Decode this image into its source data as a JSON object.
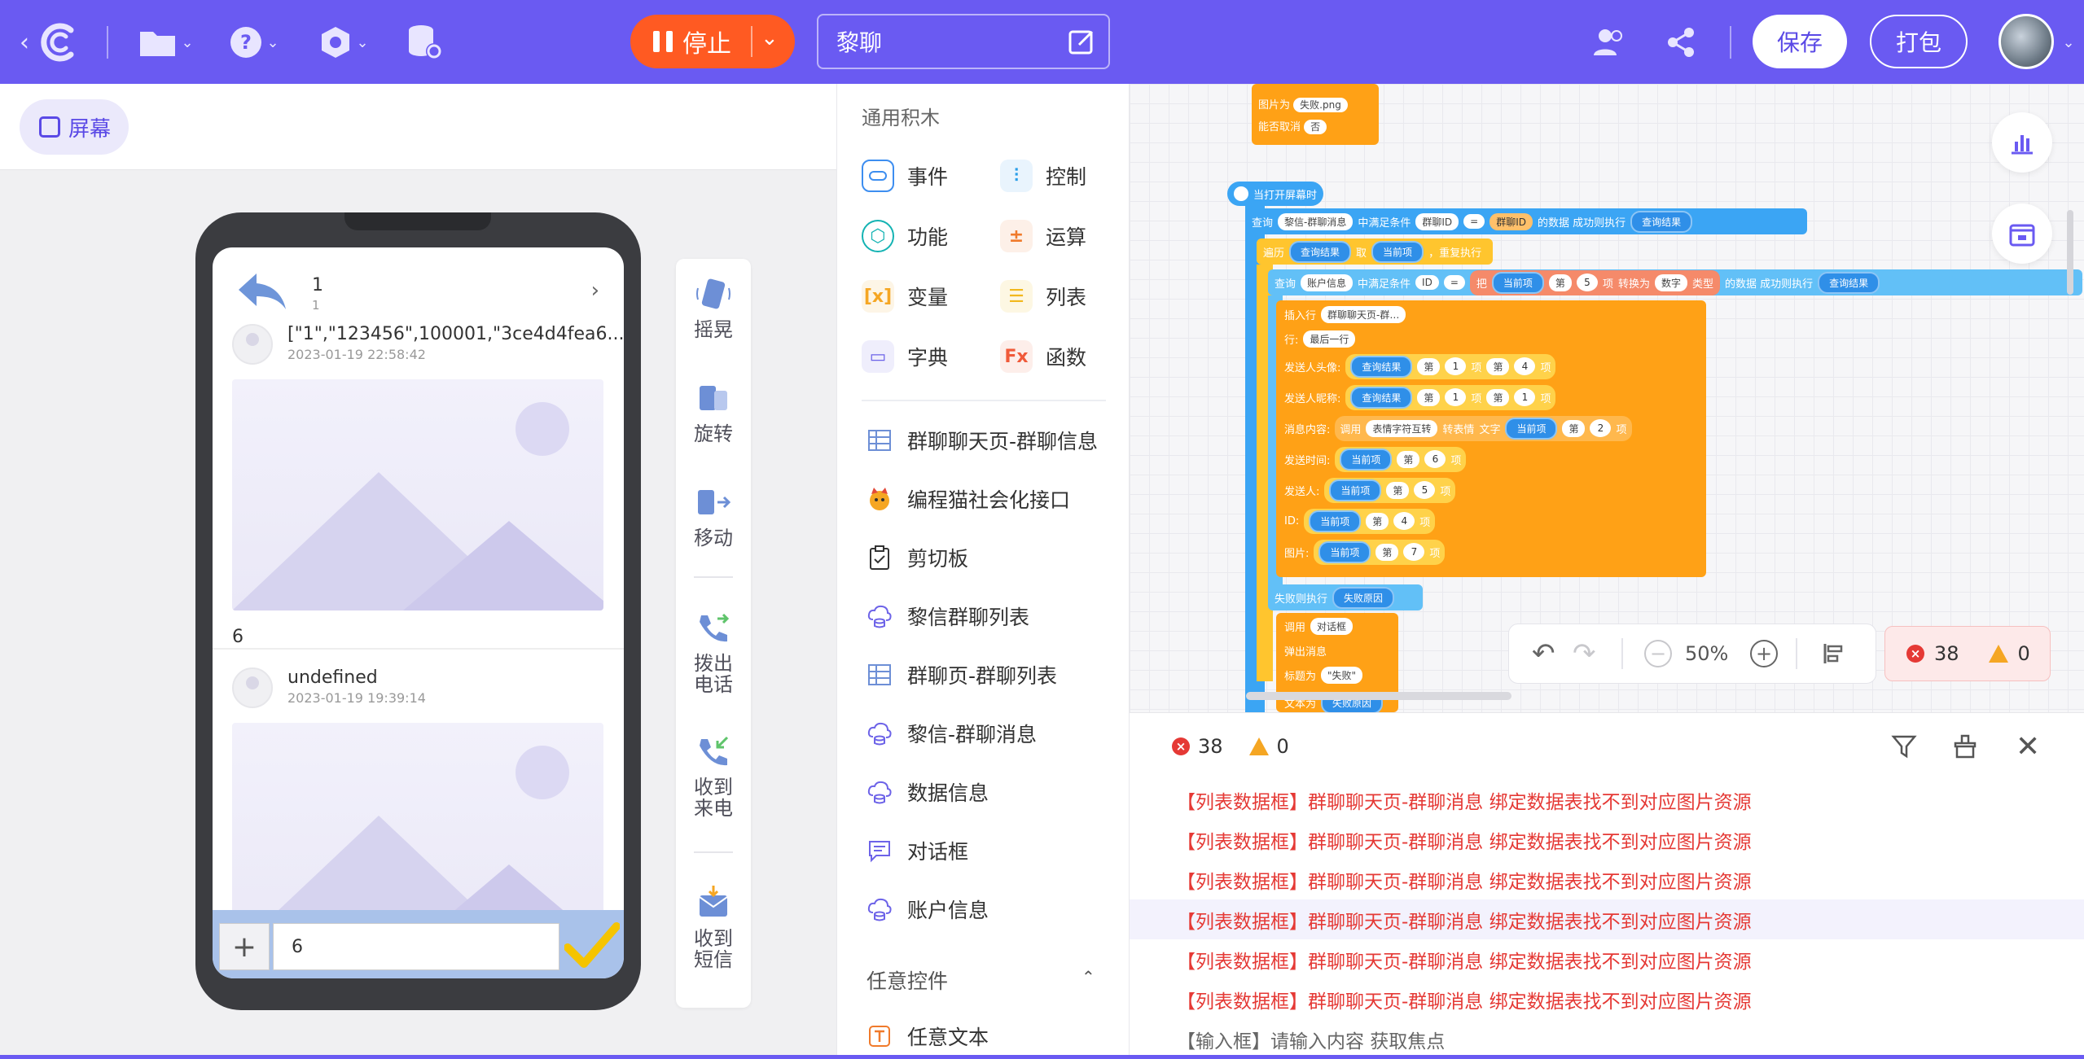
{
  "topbar": {
    "stop_label": "停止",
    "title": "黎聊",
    "save_label": "保存",
    "pack_label": "打包",
    "brand_color": "#6a5af2",
    "stop_color": "#ff5a22",
    "icons": [
      "back-chevron-icon",
      "logo-icon",
      "folder-icon",
      "help-icon",
      "settings-hex-icon",
      "database-settings-icon",
      "edit-icon",
      "users-icon",
      "share-icon"
    ]
  },
  "left": {
    "screen_label": "屏幕",
    "phone": {
      "header_title": "1",
      "header_sub": "1",
      "messages": [
        {
          "who": "[\"1\",\"123456\",100001,\"3ce4d4fea6...",
          "when": "2023-01-19 22:58:42",
          "value": "6"
        },
        {
          "who": "undefined",
          "when": "2023-01-19 19:39:14",
          "value": ""
        }
      ],
      "input_value": "6"
    },
    "tools": [
      {
        "label": "摇晃",
        "icon": "shake-icon"
      },
      {
        "label": "旋转",
        "icon": "rotate-icon"
      },
      {
        "label": "移动",
        "icon": "move-icon"
      },
      {
        "label": "拨出\n电话",
        "icon": "outgoing-call-icon"
      },
      {
        "label": "收到\n来电",
        "icon": "incoming-call-icon"
      },
      {
        "label": "收到\n短信",
        "icon": "sms-icon"
      }
    ]
  },
  "palette": {
    "header": "通用积木",
    "categories": [
      {
        "label": "事件",
        "color": "#3d8ef0",
        "icon": "event-icon"
      },
      {
        "label": "控制",
        "color": "#2b9ee8",
        "icon": "control-icon"
      },
      {
        "label": "功能",
        "color": "#14b3b3",
        "icon": "function-icon"
      },
      {
        "label": "运算",
        "color": "#f07a2b",
        "icon": "operation-icon"
      },
      {
        "label": "变量",
        "color": "#f5a623",
        "icon": "variable-icon"
      },
      {
        "label": "列表",
        "color": "#f2b81d",
        "icon": "list-icon"
      },
      {
        "label": "字典",
        "color": "#6c63e8",
        "icon": "dictionary-icon"
      },
      {
        "label": "函数",
        "color": "#f05a3a",
        "icon": "fx-icon"
      }
    ],
    "items": [
      {
        "label": "群聊聊天页-群聊信息",
        "icon": "table-icon"
      },
      {
        "label": "编程猫社会化接口",
        "icon": "cat-icon"
      },
      {
        "label": "剪切板",
        "icon": "clipboard-icon"
      },
      {
        "label": "黎信群聊列表",
        "icon": "cloud-db-icon"
      },
      {
        "label": "群聊页-群聊列表",
        "icon": "table-icon"
      },
      {
        "label": "黎信-群聊消息",
        "icon": "cloud-db-icon"
      },
      {
        "label": "数据信息",
        "icon": "cloud-db-icon"
      },
      {
        "label": "对话框",
        "icon": "dialog-icon"
      },
      {
        "label": "账户信息",
        "icon": "cloud-db-icon"
      }
    ],
    "section": "任意控件",
    "section_item": "任意文本"
  },
  "canvas": {
    "blocks": {
      "img_label": "图片为",
      "img_value": "失败.png",
      "cancel_label": "能否取消",
      "cancel_value": "否",
      "event": "当打开屏幕时",
      "query1": [
        "查询",
        "黎信-群聊消息",
        "中满足条件",
        "群聊ID",
        "=",
        "群聊ID",
        "的数据 成功则执行",
        "查询结果"
      ],
      "loop": [
        "遍历",
        "查询结果",
        "取",
        "当前项",
        "，重复执行"
      ],
      "query2": [
        "查询",
        "账户信息",
        "中满足条件",
        "ID",
        "=",
        "把",
        "当前项",
        "第",
        "5",
        "项",
        "转换为",
        "数字",
        "类型",
        "的数据 成功则执行",
        "查询结果"
      ],
      "insert": [
        "插入行",
        "群聊聊天页-群…"
      ],
      "row": [
        "行:",
        "最后一行"
      ],
      "f1": [
        "发送人头像:",
        "查询结果",
        "第",
        "1",
        "项",
        "第",
        "4",
        "项"
      ],
      "f2": [
        "发送人昵称:",
        "查询结果",
        "第",
        "1",
        "项",
        "第",
        "1",
        "项"
      ],
      "f3": [
        "消息内容:",
        "调用",
        "表情字符互转",
        "转表情",
        "文字",
        "当前项",
        "第",
        "2",
        "项"
      ],
      "f4": [
        "发送时间:",
        "当前项",
        "第",
        "6",
        "项"
      ],
      "f5": [
        "发送人:",
        "当前项",
        "第",
        "5",
        "项"
      ],
      "f6": [
        "ID:",
        "当前项",
        "第",
        "4",
        "项"
      ],
      "f7": [
        "图片:",
        "当前项",
        "第",
        "7",
        "项"
      ],
      "fail": [
        "失败则执行",
        "失败原因"
      ],
      "call": [
        "调用",
        "对话框"
      ],
      "popup": "弹出消息",
      "title_label": "标题为",
      "title_value": "\"失败\"",
      "text_label": "文本为",
      "text_value": "失败原因"
    },
    "zoom": "50%",
    "errors": "38",
    "warnings": "0"
  },
  "console": {
    "errors": "38",
    "warnings": "0",
    "lines": [
      "【列表数据框】群聊聊天页-群聊消息 绑定数据表找不到对应图片资源",
      "【列表数据框】群聊聊天页-群聊消息 绑定数据表找不到对应图片资源",
      "【列表数据框】群聊聊天页-群聊消息 绑定数据表找不到对应图片资源",
      "【列表数据框】群聊聊天页-群聊消息 绑定数据表找不到对应图片资源",
      "【列表数据框】群聊聊天页-群聊消息 绑定数据表找不到对应图片资源",
      "【列表数据框】群聊聊天页-群聊消息 绑定数据表找不到对应图片资源",
      "【输入框】请输入内容 获取焦点"
    ],
    "error_color": "#e53935"
  }
}
